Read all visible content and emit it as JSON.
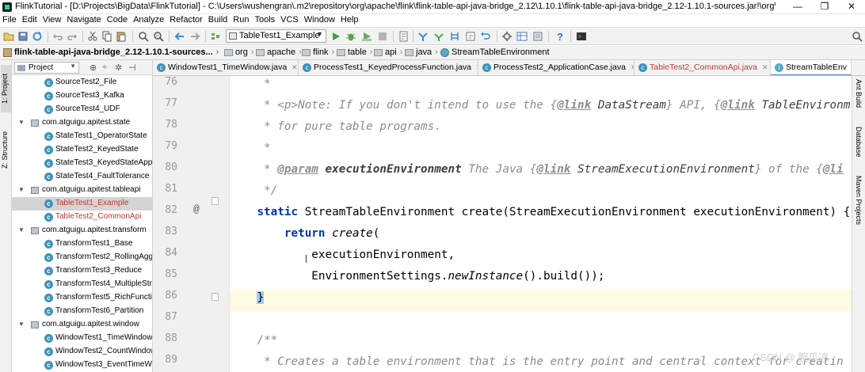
{
  "window": {
    "title": "FlinkTutorial - [D:\\Projects\\BigData\\FlinkTutorial] - C:\\Users\\wushengran\\.m2\\repository\\org\\apache\\flink\\flink-table-api-java-bridge_2.12\\1.10.1\\flink-table-api-java-bridge_2.12-1.10.1-sources.jar!\\org\\apac...",
    "minimize": "—",
    "restore": "❐",
    "close": "✕"
  },
  "menu": [
    "File",
    "Edit",
    "View",
    "Navigate",
    "Code",
    "Analyze",
    "Refactor",
    "Build",
    "Run",
    "Tools",
    "VCS",
    "Window",
    "Help"
  ],
  "toolbar": {
    "run_config": "TableTest1_Example"
  },
  "breadcrumbs": {
    "root": "flink-table-api-java-bridge_2.12-1.10.1-sources...",
    "items": [
      "org",
      "apache",
      "flink",
      "table",
      "api",
      "java"
    ],
    "class": "StreamTableEnvironment"
  },
  "left_strip": {
    "project_tab": "1: Project",
    "structure_tab": "Z: Structure"
  },
  "project_panel": {
    "selector": "Project",
    "rows": [
      {
        "kind": "class",
        "label": "SourceTest2_File",
        "red": false,
        "selected": false
      },
      {
        "kind": "class",
        "label": "SourceTest3_Kafka",
        "red": false,
        "selected": false
      },
      {
        "kind": "class",
        "label": "SourceTest4_UDF",
        "red": false,
        "selected": false
      },
      {
        "kind": "package",
        "label": "com.atguigu.apitest.state",
        "red": false,
        "selected": false
      },
      {
        "kind": "class",
        "label": "StateTest1_OperatorState",
        "red": false,
        "selected": false
      },
      {
        "kind": "class",
        "label": "StateTest2_KeyedState",
        "red": false,
        "selected": false
      },
      {
        "kind": "class",
        "label": "StateTest3_KeyedStateAppli",
        "red": false,
        "selected": false
      },
      {
        "kind": "class",
        "label": "StateTest4_FaultTolerance",
        "red": false,
        "selected": false
      },
      {
        "kind": "package",
        "label": "com.atguigu.apitest.tableapi",
        "red": false,
        "selected": false
      },
      {
        "kind": "class",
        "label": "TableTest1_Example",
        "red": true,
        "selected": true
      },
      {
        "kind": "class",
        "label": "TableTest2_CommonApi",
        "red": true,
        "selected": false
      },
      {
        "kind": "package",
        "label": "com.atguigu.apitest.transform",
        "red": false,
        "selected": false
      },
      {
        "kind": "class",
        "label": "TransformTest1_Base",
        "red": false,
        "selected": false
      },
      {
        "kind": "class",
        "label": "TransformTest2_RollingAgg",
        "red": false,
        "selected": false
      },
      {
        "kind": "class",
        "label": "TransformTest3_Reduce",
        "red": false,
        "selected": false
      },
      {
        "kind": "class",
        "label": "TransformTest4_MultipleStre",
        "red": false,
        "selected": false
      },
      {
        "kind": "class",
        "label": "TransformTest5_RichFunctic",
        "red": false,
        "selected": false
      },
      {
        "kind": "class",
        "label": "TransformTest6_Partition",
        "red": false,
        "selected": false
      },
      {
        "kind": "package",
        "label": "com.atguigu.apitest.window",
        "red": false,
        "selected": false
      },
      {
        "kind": "class",
        "label": "WindowTest1_TimeWindow",
        "red": false,
        "selected": false
      },
      {
        "kind": "class",
        "label": "WindowTest2_CountWindow",
        "red": false,
        "selected": false
      },
      {
        "kind": "class",
        "label": "WindowTest3_EventTimeWi",
        "red": false,
        "selected": false
      }
    ]
  },
  "editor_tabs": [
    {
      "label": "WindowTest1_TimeWindow.java",
      "red": false,
      "active": false
    },
    {
      "label": "ProcessTest1_KeyedProcessFunction.java",
      "red": false,
      "active": false
    },
    {
      "label": "ProcessTest2_ApplicationCase.java",
      "red": false,
      "active": false
    },
    {
      "label": "TableTest2_CommonApi.java",
      "red": true,
      "active": false
    },
    {
      "label": "StreamTableEnv",
      "red": false,
      "active": true
    }
  ],
  "right_strip": {
    "ant": "Ant Build",
    "database": "Database",
    "maven": "Maven Projects"
  },
  "line_numbers": [
    "76",
    "77",
    "78",
    "79",
    "80",
    "81",
    "82",
    "83",
    "84",
    "85",
    "86",
    "87",
    "88",
    "89"
  ],
  "code": {
    "l76": "     *",
    "l77_a": "     * ",
    "l77_tag": "<p>",
    "l77_b": "Note: If you don't intend to use the {",
    "l77_link1": "@link",
    "l77_c": " ",
    "l77_ref1": "DataStream",
    "l77_d": "} API, {",
    "l77_link2": "@link",
    "l77_e": " ",
    "l77_ref2": "TableEnvironm",
    "l78": "     * for pure table programs.",
    "l79": "     *",
    "l80_a": "     * ",
    "l80_param": "@param",
    "l80_b": " ",
    "l80_pname": "executionEnvironment",
    "l80_c": " The Java {",
    "l80_link": "@link",
    "l80_d": " ",
    "l80_ref": "StreamExecutionEnvironment",
    "l80_e": "} of the {",
    "l80_link2": "@li",
    "l81": "     */",
    "l82_kw": "static",
    "l82_rest": " StreamTableEnvironment create(StreamExecutionEnvironment executionEnvironment) {",
    "l83_kw": "return",
    "l83_m": "create",
    "l83_rest": "(",
    "l84": "executionEnvironment,",
    "l85_a": "EnvironmentSettings.",
    "l85_m": "newInstance",
    "l85_b": "().build());",
    "l86": "}",
    "l87": "",
    "l88": "/**",
    "l89": "     * Creates a table environment that is the entry point and central context for creatin"
  },
  "gutter_marker": "@",
  "watermark": "CSDN @ 腕瓜凉"
}
